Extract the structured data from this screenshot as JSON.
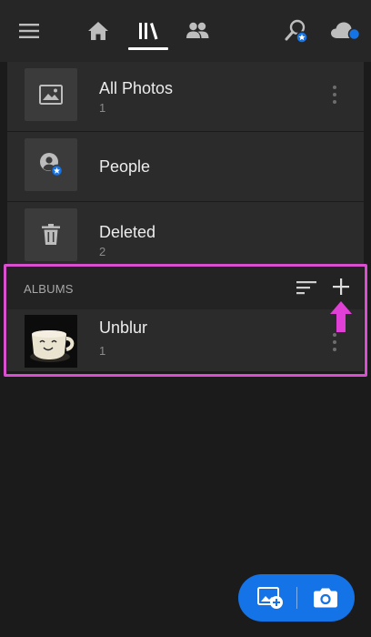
{
  "nav": {
    "menu_icon": "hamburger-menu-icon",
    "tabs": [
      {
        "icon": "home-icon",
        "active": false
      },
      {
        "icon": "library-icon",
        "active": true
      },
      {
        "icon": "people-icon",
        "active": false
      }
    ],
    "search_icon": "search-people-icon",
    "cloud_icon": "cloud-sync-icon"
  },
  "library": {
    "items": [
      {
        "label": "All Photos",
        "count": "1",
        "icon": "photo-icon"
      },
      {
        "label": "People",
        "count": "",
        "icon": "person-icon"
      },
      {
        "label": "Deleted",
        "count": "2",
        "icon": "trash-icon"
      }
    ]
  },
  "albums": {
    "header": "ALBUMS",
    "sort_icon": "sort-icon",
    "add_icon": "plus-icon",
    "items": [
      {
        "label": "Unblur",
        "count": "1",
        "thumb": "mug-thumbnail"
      }
    ]
  },
  "fab": {
    "add_photos_icon": "add-photos-icon",
    "camera_icon": "camera-icon",
    "color": "#1473e6"
  },
  "colors": {
    "background": "#1b1b1b",
    "row": "#2b2b2b",
    "highlight": "#d94fd0",
    "accent": "#1473e6"
  }
}
